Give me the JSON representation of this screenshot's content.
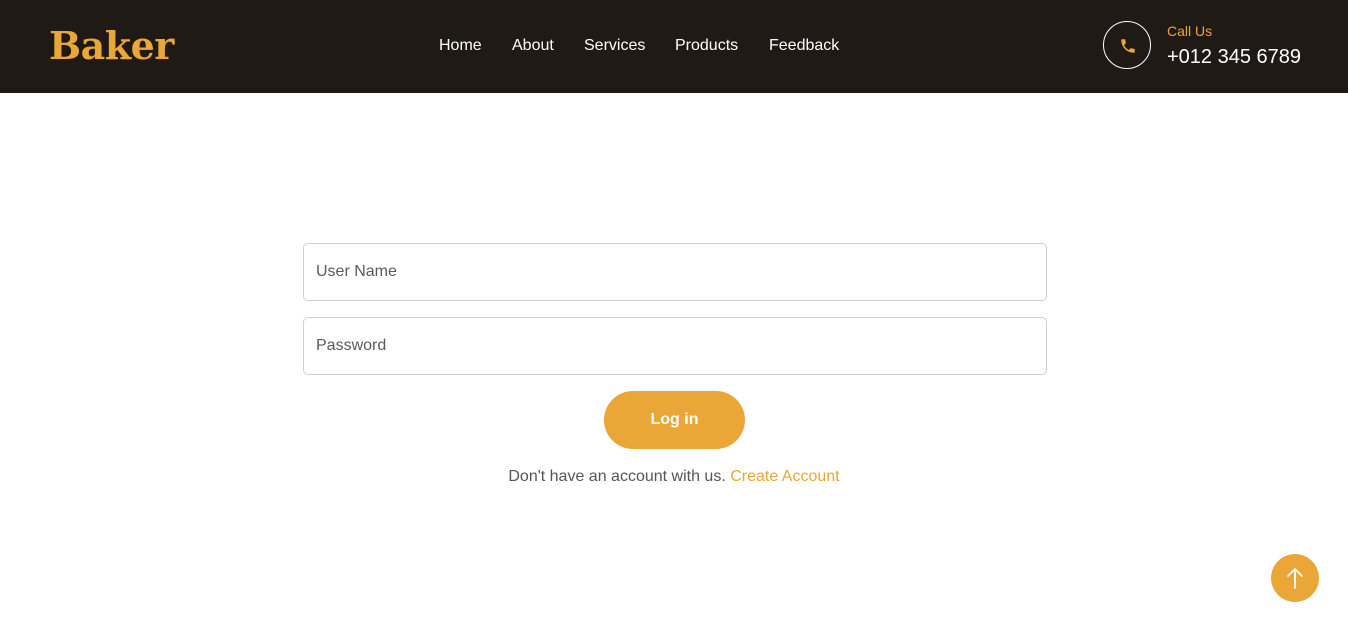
{
  "navbar": {
    "brand": "Baker",
    "links": [
      {
        "label": "Home"
      },
      {
        "label": "About"
      },
      {
        "label": "Services"
      },
      {
        "label": "Products"
      },
      {
        "label": "Feedback"
      }
    ],
    "contact": {
      "icon": "phone-icon",
      "label": "Call Us",
      "number": "+012 345 6789"
    }
  },
  "login_form": {
    "username": {
      "placeholder": "User Name",
      "value": ""
    },
    "password": {
      "placeholder": "Password",
      "value": ""
    },
    "submit_label": "Log in",
    "signup_prompt": "Don't have an account with us.",
    "signup_link": "Create Account"
  },
  "back_to_top": {
    "icon": "arrow-up-icon"
  },
  "colors": {
    "accent": "#eaa636",
    "navbar_bg": "#201a17",
    "text": "#555555"
  }
}
